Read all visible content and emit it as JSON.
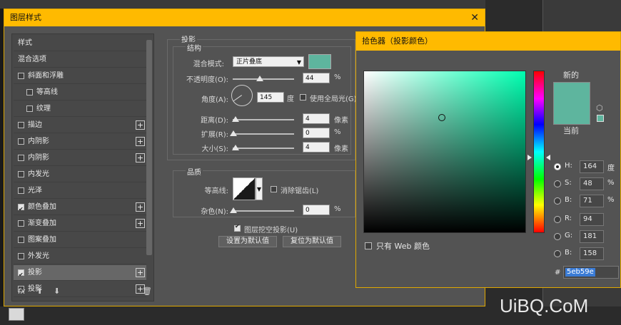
{
  "colors": {
    "accent": "#ffba00",
    "picked": "#5eb59e",
    "panel": "#535353"
  },
  "layer_style": {
    "title": "图层样式",
    "close_icon": "✕",
    "side_items": [
      {
        "label": "样式",
        "checkbox": false,
        "checked": false,
        "plus": false,
        "indent": 0,
        "active": false
      },
      {
        "label": "混合选项",
        "checkbox": false,
        "checked": false,
        "plus": false,
        "indent": 0,
        "active": false
      },
      {
        "label": "斜面和浮雕",
        "checkbox": true,
        "checked": false,
        "plus": false,
        "indent": 0,
        "active": false
      },
      {
        "label": "等高线",
        "checkbox": true,
        "checked": false,
        "plus": false,
        "indent": 1,
        "active": false
      },
      {
        "label": "纹理",
        "checkbox": true,
        "checked": false,
        "plus": false,
        "indent": 1,
        "active": false
      },
      {
        "label": "描边",
        "checkbox": true,
        "checked": false,
        "plus": true,
        "indent": 0,
        "active": false
      },
      {
        "label": "内阴影",
        "checkbox": true,
        "checked": false,
        "plus": true,
        "indent": 0,
        "active": false
      },
      {
        "label": "内阴影",
        "checkbox": true,
        "checked": false,
        "plus": true,
        "indent": 0,
        "active": false
      },
      {
        "label": "内发光",
        "checkbox": true,
        "checked": false,
        "plus": false,
        "indent": 0,
        "active": false
      },
      {
        "label": "光泽",
        "checkbox": true,
        "checked": false,
        "plus": false,
        "indent": 0,
        "active": false
      },
      {
        "label": "颜色叠加",
        "checkbox": true,
        "checked": true,
        "plus": true,
        "indent": 0,
        "active": false
      },
      {
        "label": "渐变叠加",
        "checkbox": true,
        "checked": false,
        "plus": true,
        "indent": 0,
        "active": false
      },
      {
        "label": "图案叠加",
        "checkbox": true,
        "checked": false,
        "plus": false,
        "indent": 0,
        "active": false
      },
      {
        "label": "外发光",
        "checkbox": true,
        "checked": false,
        "plus": false,
        "indent": 0,
        "active": false
      },
      {
        "label": "投影",
        "checkbox": true,
        "checked": true,
        "plus": true,
        "indent": 0,
        "active": true
      },
      {
        "label": "投影",
        "checkbox": true,
        "checked": false,
        "plus": true,
        "indent": 0,
        "active": false
      }
    ],
    "footer": {
      "fx": "fx",
      "up": "⬆",
      "down": "⬇",
      "trash": "🗑"
    },
    "drop_shadow": {
      "section_title": "投影",
      "structure_title": "结构",
      "blend_mode_label": "混合模式:",
      "blend_mode_value": "正片叠底",
      "opacity_label": "不透明度(O):",
      "opacity_value": "44",
      "opacity_unit": "%",
      "angle_label": "角度(A):",
      "angle_value": "145",
      "angle_unit": "度",
      "global_light_label": "使用全局光(G)",
      "distance_label": "距离(D):",
      "distance_value": "4",
      "distance_unit": "像素",
      "spread_label": "扩展(R):",
      "spread_value": "0",
      "spread_unit": "%",
      "size_label": "大小(S):",
      "size_value": "4",
      "size_unit": "像素",
      "quality_title": "品质",
      "contour_label": "等高线:",
      "antialias_label": "消除锯齿(L)",
      "noise_label": "杂色(N):",
      "noise_value": "0",
      "noise_unit": "%",
      "knockout_label": "图层挖空投影(U)",
      "set_default_label": "设置为默认值",
      "reset_default_label": "复位为默认值"
    }
  },
  "picker": {
    "title": "拾色器（投影颜色）",
    "new_label": "新的",
    "current_label": "当前",
    "web_only_label": "只有 Web 颜色",
    "fields": [
      {
        "label": "H:",
        "value": "164",
        "unit": "度",
        "selected": true
      },
      {
        "label": "S:",
        "value": "48",
        "unit": "%",
        "selected": false
      },
      {
        "label": "B:",
        "value": "71",
        "unit": "%",
        "selected": false
      },
      {
        "label": "R:",
        "value": "94",
        "unit": "",
        "selected": false
      },
      {
        "label": "G:",
        "value": "181",
        "unit": "",
        "selected": false
      },
      {
        "label": "B:",
        "value": "158",
        "unit": "",
        "selected": false
      }
    ],
    "hex_label": "#",
    "hex_value": "5eb59e"
  },
  "watermark": "UiBQ.CoM"
}
